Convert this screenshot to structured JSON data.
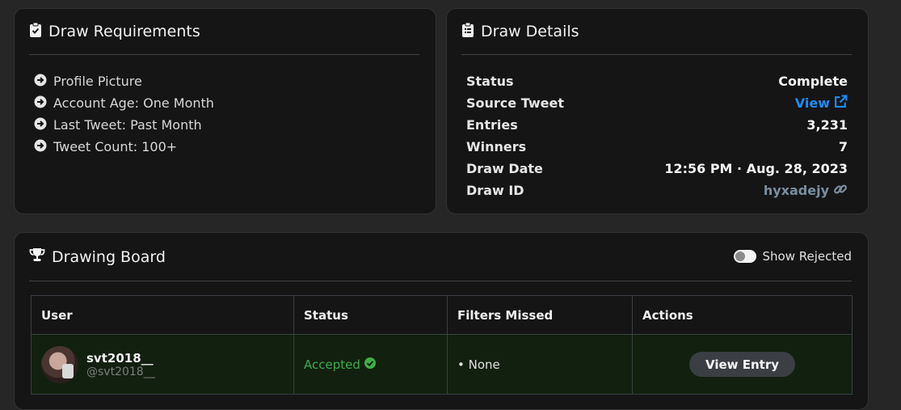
{
  "requirements": {
    "title": "Draw Requirements",
    "items": [
      {
        "label": "Profile Picture"
      },
      {
        "label": "Account Age: One Month"
      },
      {
        "label": "Last Tweet: Past Month"
      },
      {
        "label": "Tweet Count: 100+"
      }
    ]
  },
  "details": {
    "title": "Draw Details",
    "rows": [
      {
        "key": "Status",
        "value": "Complete"
      },
      {
        "key": "Source Tweet",
        "value": "View"
      },
      {
        "key": "Entries",
        "value": "3,231"
      },
      {
        "key": "Winners",
        "value": "7"
      },
      {
        "key": "Draw Date",
        "value": "12:56 PM · Aug. 28, 2023"
      },
      {
        "key": "Draw ID",
        "value": "hyxadejy"
      }
    ],
    "colors": {
      "link": "#1d8cf8",
      "id": "#7a8ea0"
    }
  },
  "board": {
    "title": "Drawing Board",
    "toggle_label": "Show Rejected",
    "toggle_on": false,
    "columns": [
      "User",
      "Status",
      "Filters Missed",
      "Actions"
    ],
    "rows": [
      {
        "name": "svt2018__",
        "handle": "@svt2018__",
        "status": "Accepted",
        "filters_missed": "• None",
        "action": "View Entry"
      }
    ],
    "colors": {
      "accepted": "#3fae4a",
      "row_bg": "#12200f"
    }
  },
  "icons": {
    "requirements": "clipboard-check-icon",
    "details": "clipboard-list-icon",
    "board": "trophy-icon",
    "list_bullet": "arrow-circle-right-icon",
    "external": "external-link-icon",
    "link": "link-icon",
    "check": "check-circle-icon"
  }
}
